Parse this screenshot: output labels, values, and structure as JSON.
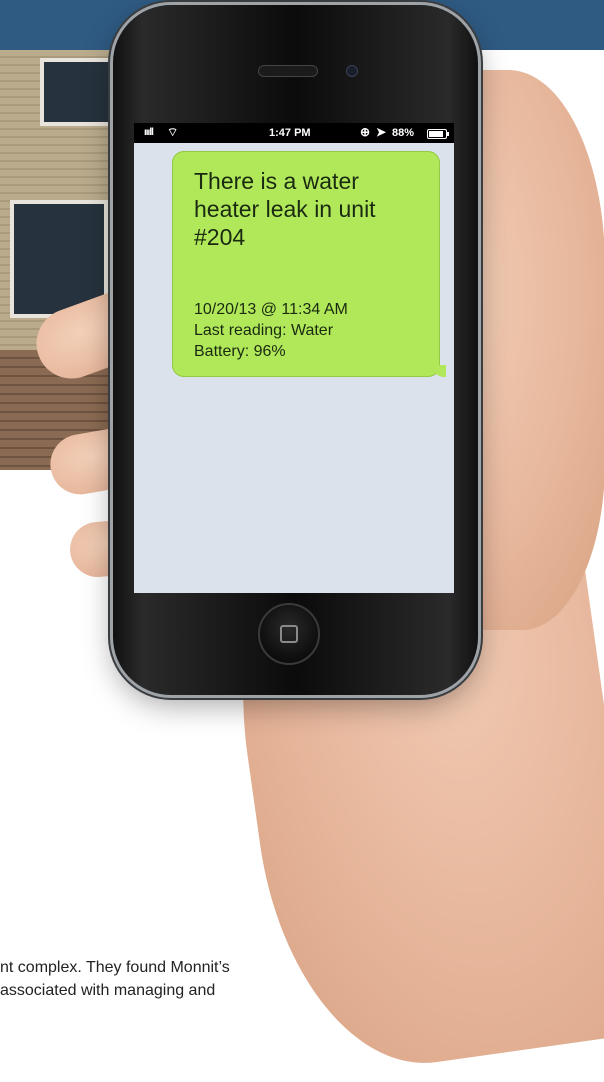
{
  "status_bar": {
    "signal": "ıııll",
    "wifi_icon": "wifi-icon",
    "time": "1:47 PM",
    "lock_icon": "rotation-lock-icon",
    "location_icon": "location-arrow-icon",
    "battery_percent": "88%",
    "battery_icon": "battery-icon"
  },
  "message": {
    "text": "There is a water heater leak in unit #204",
    "datetime": "10/20/13 @ 11:34 AM",
    "reading": "Last reading: Water",
    "battery": "Battery: 96%",
    "bubble_color": "#b1e85a"
  },
  "body": {
    "line1": "nt complex. They found Monnit’s",
    "line2": "associated with managing and"
  },
  "colors": {
    "top_band": "#2f5a82"
  }
}
